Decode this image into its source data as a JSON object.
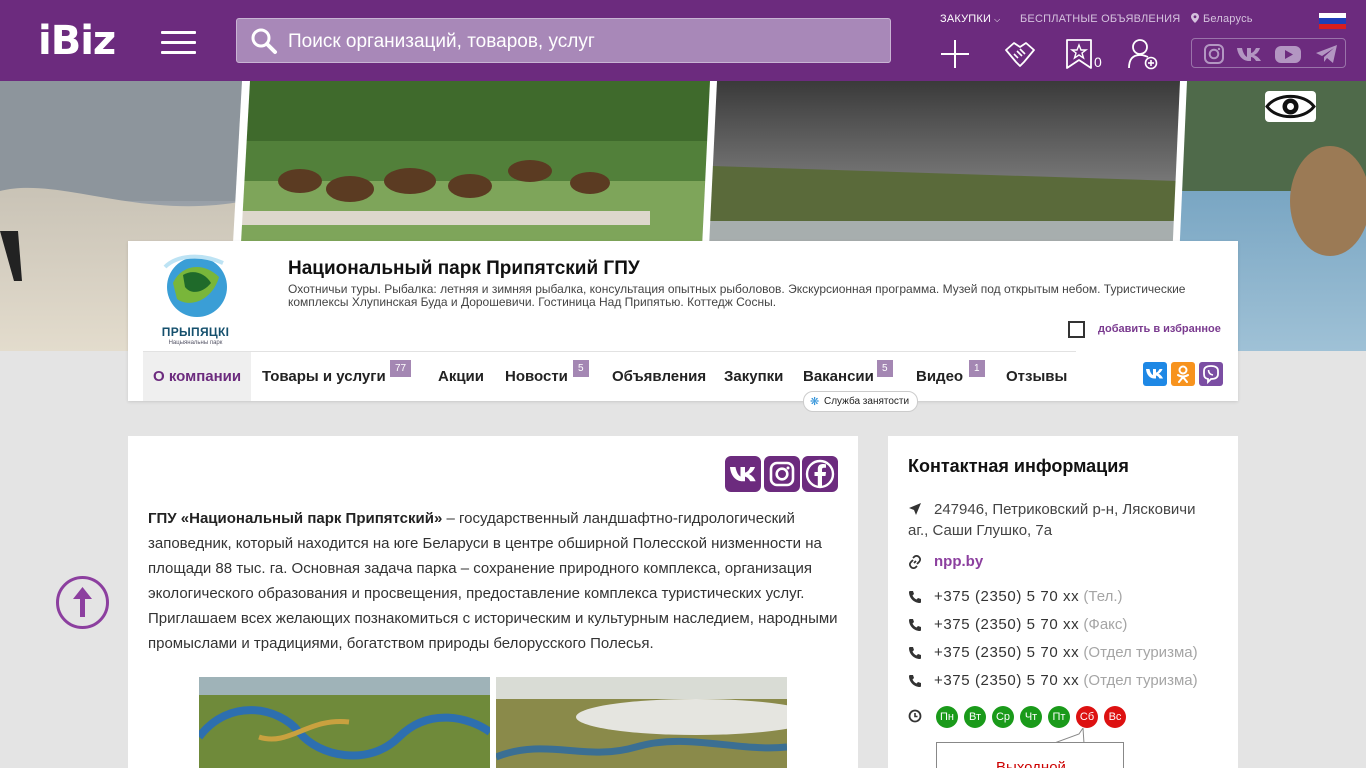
{
  "header": {
    "logo": "iBiz",
    "search_placeholder": "Поиск организаций, товаров, услуг",
    "nav": {
      "purchases": "ЗАКУПКИ",
      "free_ads": "БЕСПЛАТНЫЕ ОБЪЯВЛЕНИЯ",
      "region": "Беларусь"
    },
    "favorites_count": "0"
  },
  "company": {
    "title": "Национальный парк Припятский ГПУ",
    "description": "Охотничьи туры. Рыбалка: летняя и зимняя рыбалка, консультация опытных рыболовов. Экскурсионная программа. Музей под открытым небом. Туристические комплексы Хлупинская Буда и Дорошевичи. Гостиница Над Припятью. Коттедж Сосны.",
    "logo_text": "ПРЫПЯЦКІ",
    "logo_subtext": "Нацыянальны парк",
    "add_favorite": "добавить в избранное"
  },
  "tabs": [
    {
      "label": "О компании"
    },
    {
      "label": "Товары и услуги",
      "badge": "77"
    },
    {
      "label": "Акции"
    },
    {
      "label": "Новости",
      "badge": "5"
    },
    {
      "label": "Объявления"
    },
    {
      "label": "Закупки"
    },
    {
      "label": "Вакансии",
      "badge": "5"
    },
    {
      "label": "Видео",
      "badge": "1"
    },
    {
      "label": "Отзывы"
    }
  ],
  "employment_label": "Служба занятости",
  "about": {
    "lead": "ГПУ «Национальный парк Припятский»",
    "text": " – государственный ландшафтно-гидрологический заповедник, который находится на юге Беларуси в центре обширной Полесской низменности на площади 88 тыс. га. Основная задача парка – сохранение природного комплекса, организация экологического образования и просвещения, предоставление комплекса туристических услуг. Приглашаем всех желающих познакомиться с историческим и культурным наследием, народными промыслами и традициями, богатством природы белорусского Полесья."
  },
  "contact": {
    "heading": "Контактная информация",
    "address": "247946, Петриковский р-н, Лясковичи аг., Саши Глушко, 7а",
    "site": "npp.by",
    "phones": [
      {
        "number": "+375 (2350) 5 70 xx",
        "note": "(Тел.)"
      },
      {
        "number": "+375 (2350) 5 70 xx",
        "note": "(Факс)"
      },
      {
        "number": "+375 (2350) 5 70 xx",
        "note": "(Отдел туризма)"
      },
      {
        "number": "+375 (2350) 5 70 xx",
        "note": "(Отдел туризма)"
      }
    ],
    "days": [
      {
        "label": "Пн",
        "status": "open"
      },
      {
        "label": "Вт",
        "status": "open"
      },
      {
        "label": "Ср",
        "status": "open"
      },
      {
        "label": "Чт",
        "status": "open"
      },
      {
        "label": "Пт",
        "status": "open"
      },
      {
        "label": "Сб",
        "status": "closed"
      },
      {
        "label": "Вс",
        "status": "closed"
      }
    ],
    "day_off": "Выходной"
  },
  "colors": {
    "brand": "#6c2b7e",
    "open_day": "#1a9a1a",
    "closed_day": "#dd1111"
  },
  "icons": [
    "search-icon",
    "menu-icon",
    "plus-icon",
    "handshake-icon",
    "star-icon",
    "user-add-icon",
    "instagram-icon",
    "vk-icon",
    "youtube-icon",
    "telegram-icon",
    "eye-icon",
    "location-icon",
    "link-icon",
    "phone-icon",
    "clock-icon",
    "arrow-up-icon",
    "facebook-icon",
    "odnoklassniki-icon",
    "viber-icon"
  ]
}
